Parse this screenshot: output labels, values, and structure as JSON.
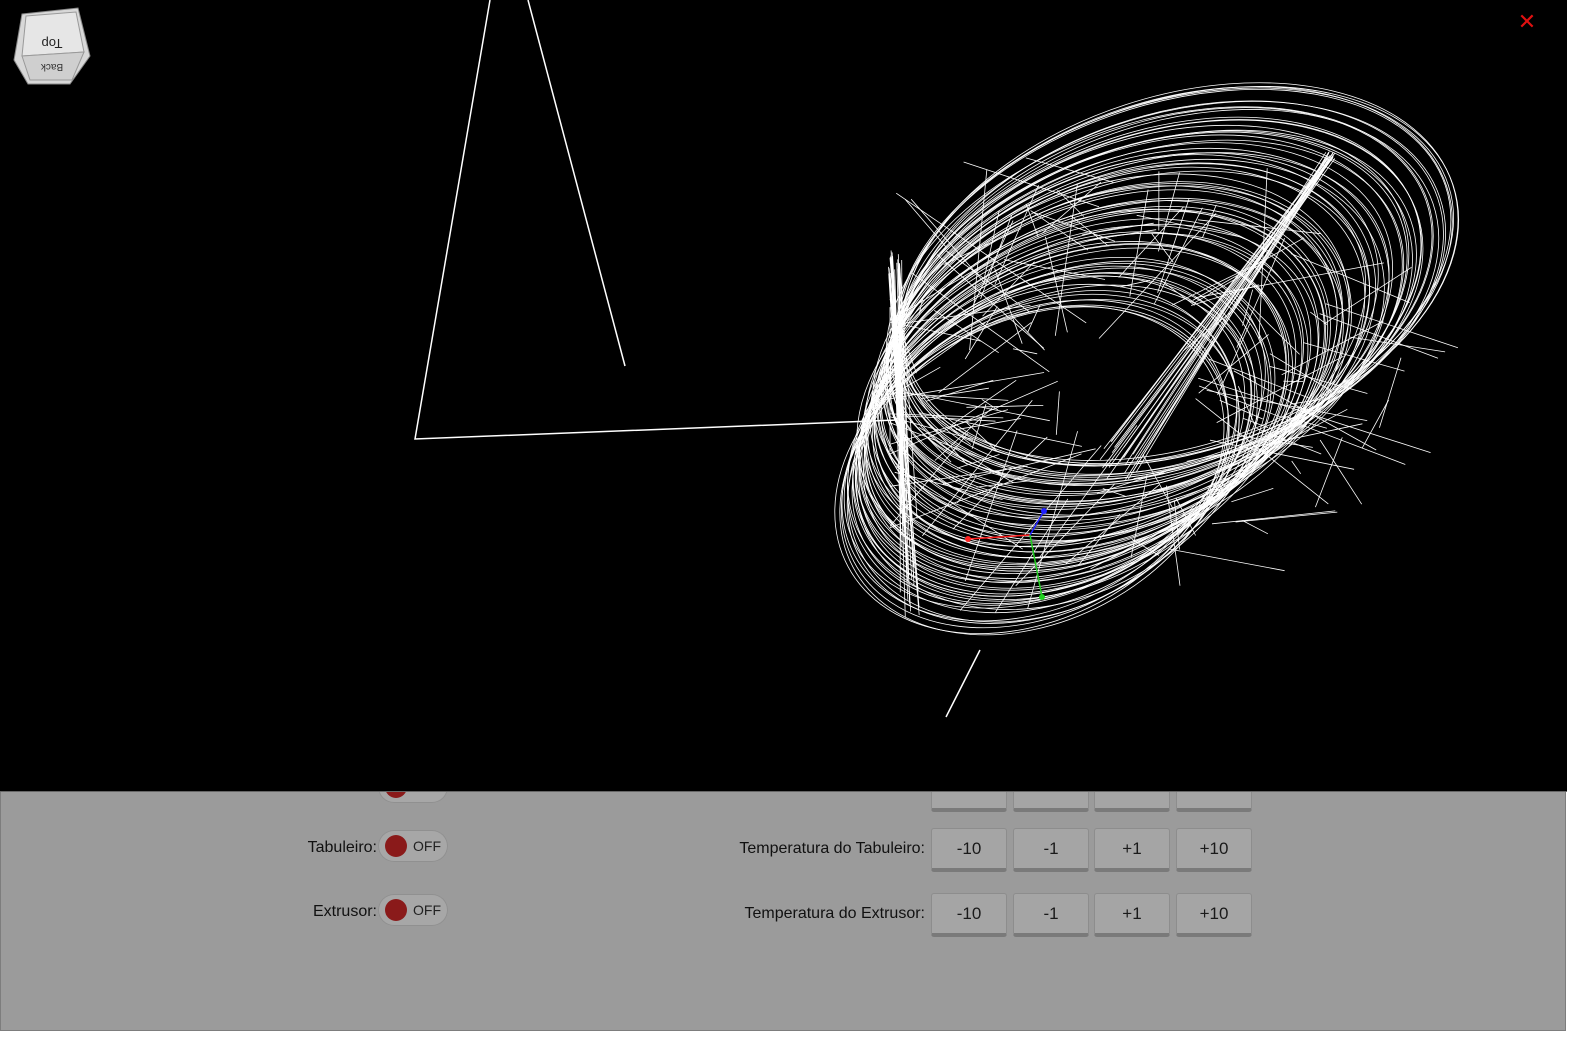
{
  "viewer": {
    "view_cube": {
      "top_face": "Top",
      "front_face": "Back"
    },
    "close_icon": "close-icon",
    "accent_colors": {
      "background": "#000000",
      "toolpath": "#ffffff",
      "axis_x": "#ff2020",
      "axis_y": "#20d020",
      "axis_z": "#2020ff",
      "close": "#e01010"
    }
  },
  "controls": {
    "switches": [
      {
        "label": "Tabuleiro:",
        "state": "OFF"
      },
      {
        "label": "Extrusor:",
        "state": "OFF"
      }
    ],
    "temperature_rows": [
      {
        "label": "Temperatura do Tabuleiro:",
        "buttons": [
          "-10",
          "-1",
          "+1",
          "+10"
        ]
      },
      {
        "label": "Temperatura do Extrusor:",
        "buttons": [
          "-10",
          "-1",
          "+1",
          "+10"
        ]
      }
    ]
  }
}
